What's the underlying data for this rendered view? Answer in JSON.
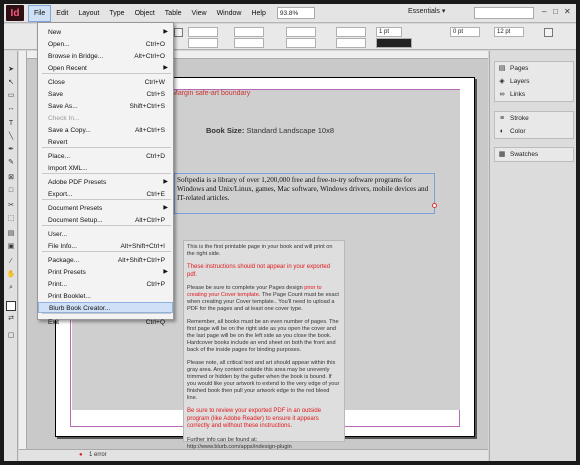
{
  "app": {
    "logo": "Id"
  },
  "menubar": {
    "items": [
      "File",
      "Edit",
      "Layout",
      "Type",
      "Object",
      "Table",
      "View",
      "Window",
      "Help"
    ],
    "zoom": "93.8%",
    "workspace": "Essentials",
    "workspace_arrow": "▾"
  },
  "controlbar": {
    "x": "0 pt",
    "stroke_weight": "1 pt",
    "font_size": "12 pt"
  },
  "file_menu": {
    "items": [
      {
        "label": "New",
        "shortcut": "",
        "submenu": true
      },
      {
        "label": "Open...",
        "shortcut": "Ctrl+O"
      },
      {
        "label": "Browse in Bridge...",
        "shortcut": "Alt+Ctrl+O"
      },
      {
        "label": "Open Recent",
        "shortcut": "",
        "submenu": true
      },
      {
        "label": "Close",
        "shortcut": "Ctrl+W"
      },
      {
        "label": "Save",
        "shortcut": "Ctrl+S"
      },
      {
        "label": "Save As...",
        "shortcut": "Shift+Ctrl+S"
      },
      {
        "label": "Check In...",
        "shortcut": "",
        "disabled": true
      },
      {
        "label": "Save a Copy...",
        "shortcut": "Alt+Ctrl+S"
      },
      {
        "label": "Revert",
        "shortcut": ""
      },
      {
        "label": "Place...",
        "shortcut": "Ctrl+D"
      },
      {
        "label": "Import XML...",
        "shortcut": ""
      },
      {
        "label": "Adobe PDF Presets",
        "shortcut": "",
        "submenu": true
      },
      {
        "label": "Export...",
        "shortcut": "Ctrl+E"
      },
      {
        "label": "Document Presets",
        "shortcut": "",
        "submenu": true
      },
      {
        "label": "Document Setup...",
        "shortcut": "Alt+Ctrl+P"
      },
      {
        "label": "User...",
        "shortcut": ""
      },
      {
        "label": "File Info...",
        "shortcut": "Alt+Shift+Ctrl+I"
      },
      {
        "label": "Package...",
        "shortcut": "Alt+Shift+Ctrl+P"
      },
      {
        "label": "Print Presets",
        "shortcut": "",
        "submenu": true
      },
      {
        "label": "Print...",
        "shortcut": "Ctrl+P"
      },
      {
        "label": "Print Booklet...",
        "shortcut": ""
      },
      {
        "label": "Blurb Book Creator...",
        "shortcut": ""
      },
      {
        "label": "Exit",
        "shortcut": "Ctrl+Q"
      }
    ]
  },
  "document": {
    "safe_label": "Margin safe-art boundary",
    "book_size_label": "Book Size:",
    "book_size_value": "Standard Landscape 10x8",
    "body_text": "Softpedia is a library of over 1,200,000 free and free-to-try software programs for Windows and Unix/Linux, games, Mac software, Windows drivers, mobile devices and IT-related articles.",
    "instructions": {
      "p1": "This is the first printable page in your book and will print on the right side.",
      "p2": "These instructions should not appear in your exported pdf.",
      "p3a": "Please be sure to complete your Pages design ",
      "p3b": "prior to creating your Cover template.",
      "p3c": " The Page Count must be exact when creating your Cover template.. You'll need to upload a PDF for the pages and at least one cover type.",
      "p4": "Remember, all books must be an even number of pages. The first page will be on the right side as you open the cover and the last page will be on the left side as you close the book. Hardcover books include an end sheet on both the front and back of the inside pages for binding purposes.",
      "p5": "Please note, all critical text and art should appear within this gray area. Any content outside this area may be unevenly trimmed or hidden by the gutter when the book is bound. If you would like your artwork to extend to the very edge of your finished book then pull your artwork edge to the red bleed line.",
      "p6": "Be sure to review your exported PDF in an outside program (like Adobe Reader) to ensure it appears correctly and without these instructions.",
      "p7": "Further info can be found at: http://www.blurb.com/apps/indesign-plugin"
    }
  },
  "statusbar": {
    "errors": "1 error"
  },
  "panels": {
    "group1": [
      "Pages",
      "Layers",
      "Links"
    ],
    "group2": [
      "Stroke",
      "Color"
    ],
    "group3": [
      "Swatches"
    ]
  },
  "colors": {
    "accent_red": "#e0191c",
    "highlight": "#cfe0f7",
    "margin_guide": "#b46ab4"
  }
}
